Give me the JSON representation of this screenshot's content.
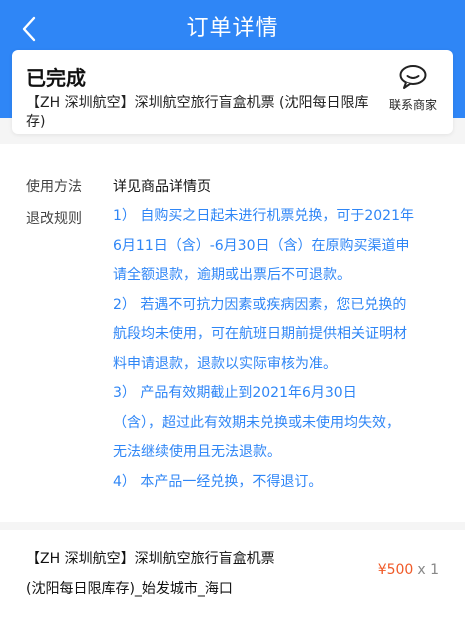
{
  "header": {
    "title": "订单详情"
  },
  "card": {
    "status": "已完成",
    "product_short": "【ZH 深圳航空】深圳航空旅行盲盒机票 (沈阳每日限库存)",
    "contact_label": "联系商家"
  },
  "info": {
    "usage_label": "使用方法",
    "usage_value": "详见商品详情页",
    "refund_label": "退改规则",
    "rules_lines": [
      "1） 自购买之日起未进行机票兑换，可于2021年",
      "6月11日（含）-6月30日（含）在原购买渠道申",
      "请全额退款，逾期或出票后不可退款。",
      "2） 若遇不可抗力因素或疾病因素，您已兑换的",
      "航段均未使用，可在航班日期前提供相关证明材",
      "料申请退款，退款以实际审核为准。",
      "3） 产品有效期截止到2021年6月30日",
      "（含），超过此有效期未兑换或未使用均失效，",
      "无法继续使用且无法退款。",
      "4） 本产品一经兑换，不得退订。"
    ]
  },
  "order_item": {
    "name_line1": "【ZH 深圳航空】深圳航空旅行盲盒机票",
    "name_line2": "(沈阳每日限库存)_始发城市_海口",
    "price": "¥500",
    "quantity": "x 1"
  },
  "icons": {
    "back": "chevron-left-icon",
    "contact": "chat-bubble-icon"
  },
  "colors": {
    "header_blue": "#2f86f6",
    "rule_text_blue": "#2f86f6",
    "price_orange": "#f05a28"
  }
}
